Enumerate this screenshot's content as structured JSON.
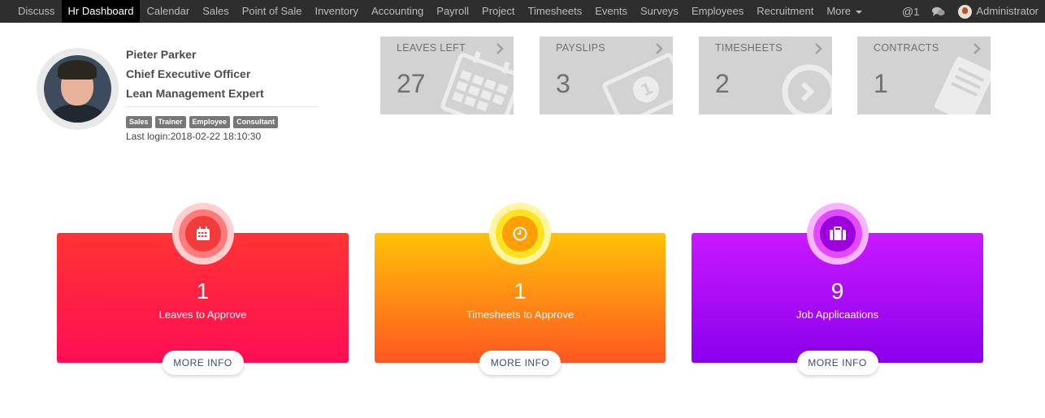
{
  "navbar": {
    "items": [
      "Discuss",
      "Hr Dashboard",
      "Calendar",
      "Sales",
      "Point of Sale",
      "Inventory",
      "Accounting",
      "Payroll",
      "Project",
      "Timesheets",
      "Events",
      "Surveys",
      "Employees",
      "Recruitment"
    ],
    "more_label": "More",
    "active": "Hr Dashboard",
    "mentions_symbol": "@",
    "mentions_count": "1",
    "user_name": "Administrator"
  },
  "profile": {
    "name": "Pieter Parker",
    "job_title": "Chief Executive Officer",
    "expertise": "Lean Management Expert",
    "tags": [
      "Sales",
      "Trainer",
      "Employee",
      "Consultant"
    ],
    "last_login": "Last login:2018-02-22 18:10:30"
  },
  "tiles": [
    {
      "label": "LEAVES LEFT",
      "value": "27",
      "icon": "calendar-icon"
    },
    {
      "label": "PAYSLIPS",
      "value": "3",
      "icon": "money-icon"
    },
    {
      "label": "TIMESHEETS",
      "value": "2",
      "icon": "clock-icon"
    },
    {
      "label": "CONTRACTS",
      "value": "1",
      "icon": "book-icon"
    }
  ],
  "cards": [
    {
      "count": "1",
      "text": "Leaves to Approve",
      "button": "MORE INFO",
      "icon": "calendar-icon",
      "color": "#ff1f47"
    },
    {
      "count": "1",
      "text": "Timesheets to Approve",
      "button": "MORE INFO",
      "icon": "clock-icon",
      "color": "#ff9800"
    },
    {
      "count": "9",
      "text": "Job Applicaations",
      "button": "MORE INFO",
      "icon": "briefcase-icon",
      "color": "#a700f5"
    }
  ]
}
